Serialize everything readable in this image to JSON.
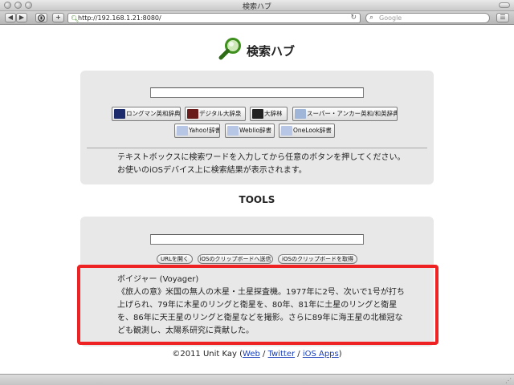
{
  "window": {
    "title": "検索ハブ"
  },
  "toolbar": {
    "back_icon": "◀",
    "forward_icon": "▶",
    "add_icon": "+",
    "url": "http://192.168.1.21:8080/",
    "search_placeholder": "Google"
  },
  "page": {
    "title": "検索ハブ",
    "search_value": "",
    "dictionaries": [
      {
        "label": "ロングマン英和辞典",
        "icon_color": "#1c2b6b"
      },
      {
        "label": "デジタル大辞泉",
        "icon_color": "#6b1a1a"
      },
      {
        "label": "大辞林",
        "icon_color": "#222222"
      },
      {
        "label": "スーパー・アンカー英和/和英辞典",
        "icon_color": "#9fb6d9"
      },
      {
        "label": "Yahoo!辞書",
        "icon_color": "#b8c6e6"
      },
      {
        "label": "Weblio辞書",
        "icon_color": "#b8c6e6"
      },
      {
        "label": "OneLook辞書",
        "icon_color": "#b8c6e6"
      }
    ],
    "help_text": "テキストボックスに検索ワードを入力してから任意のボタンを押してください。お使いのiOSデバイス上に検索結果が表示されます。",
    "tools_heading": "TOOLS",
    "tools_input_value": "",
    "tools_buttons": [
      "URLを開く",
      "iOSのクリップボードへ送信",
      "iOSのクリップボードを取得"
    ],
    "result_text": "ボイジャー (Voyager)\n《旅人の意》米国の無人の木星・土星探査機。1977年に2号、次いで1号が打ち上げられ、79年に木星のリングと衛星を、80年、81年に土星のリングと衛星を、86年に天王星のリングと衛星などを撮影。さらに89年に海王星の北極冠なども観測し、太陽系研究に貢献した。",
    "footer": {
      "copyright": "©2011 Unit Kay (",
      "link_web": "Web",
      "sep1": " / ",
      "link_twitter": "Twitter",
      "sep2": " / ",
      "link_ios": "iOS Apps",
      "close": ")"
    }
  },
  "colors": {
    "panel": "#e8e8e8",
    "highlight": "#ee2222",
    "link": "#1a3fb8",
    "logo_green": "#3f8f1f"
  }
}
